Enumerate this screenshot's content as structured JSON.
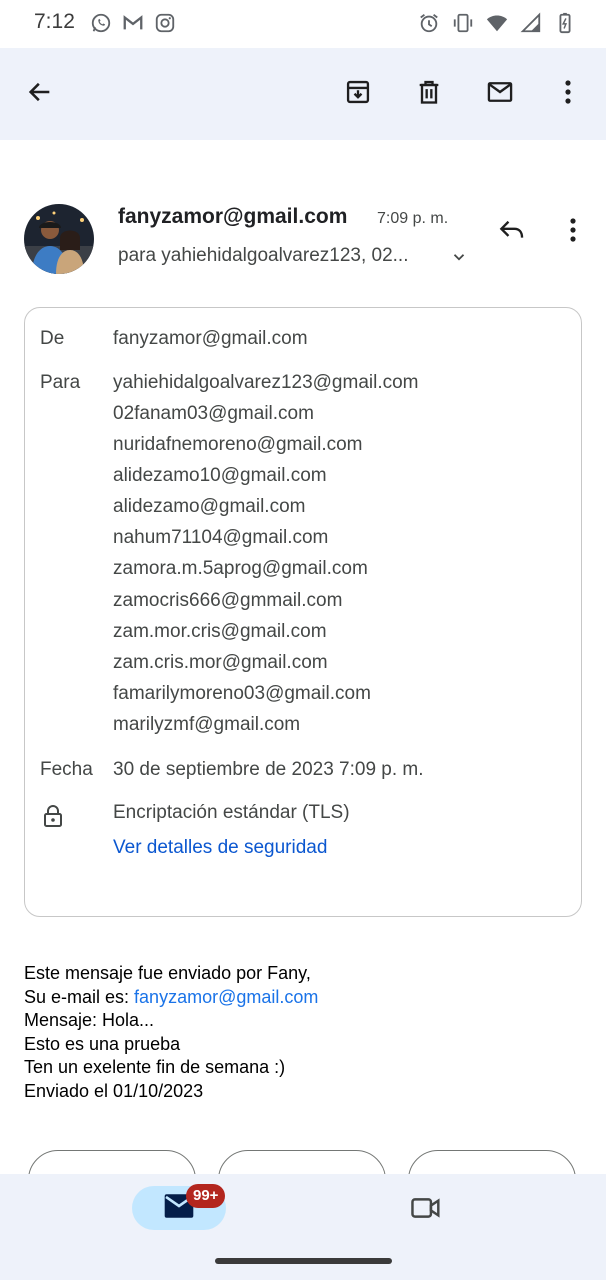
{
  "status_bar": {
    "time": "7:12",
    "left_icons": [
      "whatsapp-icon",
      "gmail-icon",
      "instagram-icon"
    ],
    "right_icons": [
      "alarm-icon",
      "vibrate-icon",
      "wifi-icon",
      "signal-icon",
      "battery-icon"
    ]
  },
  "toolbar": {
    "back_icon": "arrow-back-icon",
    "actions": [
      "archive-icon",
      "delete-icon",
      "mark-unread-icon",
      "more-vert-icon"
    ]
  },
  "message_header": {
    "sender": "fanyzamor@gmail.com",
    "time": "7:09 p. m.",
    "recipients_summary": "para yahiehidalgoalvarez123, 02...",
    "reply_icon": "reply-icon",
    "more_icon": "more-vert-icon"
  },
  "details": {
    "from_label": "De",
    "from_value": "fanyzamor@gmail.com",
    "to_label": "Para",
    "to_values": [
      "yahiehidalgoalvarez123@gmail.com",
      "02fanam03@gmail.com",
      "nuridafnemoreno@gmail.com",
      "alidezamo10@gmail.com",
      "alidezamo@gmail.com",
      "nahum71104@gmail.com",
      "zamora.m.5aprog@gmail.com",
      "zamocris666@gmmail.com",
      "zam.mor.cris@gmail.com",
      "zam.cris.mor@gmail.com",
      "famarilymoreno03@gmail.com",
      "marilyzmf@gmail.com"
    ],
    "date_label": "Fecha",
    "date_value": "30 de septiembre de 2023 7:09 p. m.",
    "encryption": "Encriptación estándar (TLS)",
    "security_link": "Ver detalles de seguridad"
  },
  "body": {
    "line1": "Este mensaje fue enviado por Fany,",
    "line2_prefix": "Su e-mail es: ",
    "line2_link": "fanyzamor@gmail.com",
    "line3": "Mensaje: Hola...",
    "line4": "Esto es una prueba",
    "line5": "Ten un exelente fin de semana :)",
    "line6": "Enviado el 01/10/2023"
  },
  "bottom_nav": {
    "mail_badge": "99+",
    "mail_icon": "mail-icon",
    "meet_icon": "video-icon"
  },
  "colors": {
    "appbar_bg": "#eef2fa",
    "link": "#0b57d0",
    "badge": "#b3261e",
    "nav_active": "#c2e7ff"
  }
}
